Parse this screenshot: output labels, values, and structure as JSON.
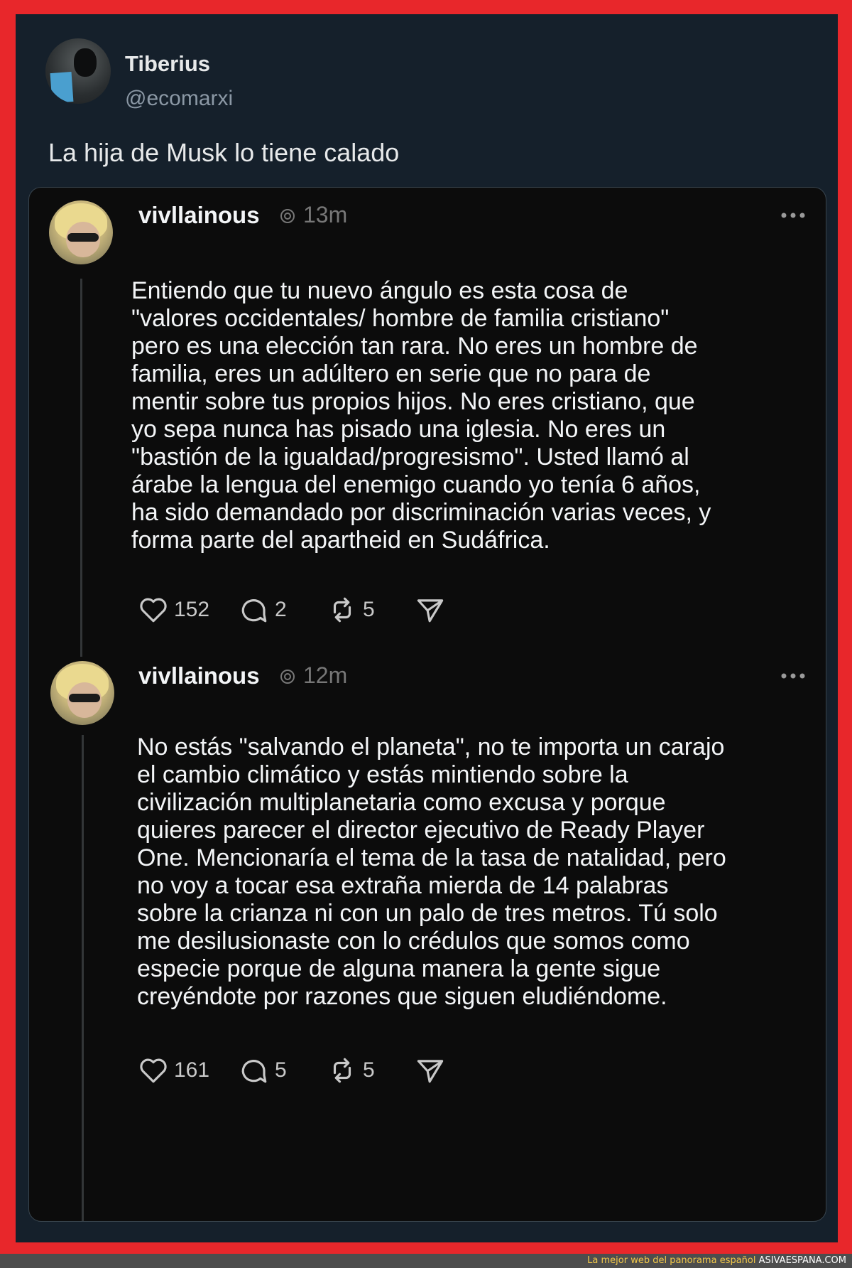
{
  "author": {
    "display_name": "Tiberius",
    "handle": "@ecomarxi",
    "avatar_icon": "profile-photo"
  },
  "tweet": {
    "text": "La hija de Musk lo tiene calado"
  },
  "quoted_thread": {
    "posts": [
      {
        "username": "vivllainous",
        "time": "13m",
        "body": "Entiendo que tu nuevo ángulo es esta cosa de\n\"valores occidentales/ hombre de familia cristiano\"\npero es una elección tan rara. No eres un hombre de\nfamilia, eres un adúltero en serie que no para de\nmentir sobre tus propios hijos. No eres cristiano, que\nyo sepa nunca has pisado una iglesia. No eres un\n\"bastión de la igualdad/progresismo\". Usted llamó al\nárabe la lengua del enemigo cuando yo tenía 6 años,\nha sido demandado por discriminación varias veces, y\nforma parte del apartheid en Sudáfrica.",
        "likes": "152",
        "replies": "2",
        "reposts": "5"
      },
      {
        "username": "vivllainous",
        "time": "12m",
        "body": "No estás \"salvando el planeta\", no te importa un carajo\nel cambio climático y estás mintiendo sobre la\ncivilización multiplanetaria como excusa y porque\nquieres parecer el director ejecutivo de Ready Player\nOne. Mencionaría el tema de la tasa de natalidad, pero\nno voy a tocar esa extraña mierda de 14 palabras\nsobre la crianza ni con un palo de tres metros. Tú solo\nme desilusionaste con lo crédulos que somos como\nespecie porque de alguna manera la gente sigue\ncreyéndote por razones que siguen eludiéndome.",
        "likes": "161",
        "replies": "5",
        "reposts": "5"
      }
    ]
  },
  "footer": {
    "tagline": "La mejor web del panorama español",
    "site": "ASIVAESPANA.COM"
  },
  "colors": {
    "border": "#e8272b",
    "background": "#15202b",
    "quote_background": "#0c0c0c",
    "footer_tagline": "#f3c94a"
  }
}
